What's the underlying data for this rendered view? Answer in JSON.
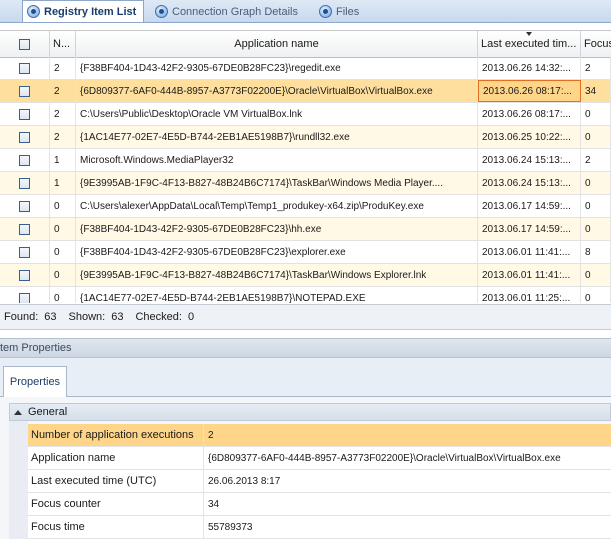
{
  "tabs": [
    {
      "label": "Registry Item List",
      "active": true,
      "icon": "registry-icon"
    },
    {
      "label": "Connection Graph Details",
      "active": false,
      "icon": "graph-icon"
    },
    {
      "label": "Files",
      "active": false,
      "icon": "files-icon"
    }
  ],
  "grid": {
    "columns": [
      {
        "key": "check",
        "label": ""
      },
      {
        "key": "n",
        "label": "N..."
      },
      {
        "key": "app",
        "label": "Application name"
      },
      {
        "key": "last",
        "label": "Last executed tim..."
      },
      {
        "key": "focus",
        "label": "Focus"
      }
    ],
    "rows": [
      {
        "n": "2",
        "app": "{F38BF404-1D43-42F2-9305-67DE0B28FC23}\\regedit.exe",
        "last": "2013.06.26  14:32:...",
        "focus": "2"
      },
      {
        "n": "2",
        "app": "{6D809377-6AF0-444B-8957-A3773F02200E}\\Oracle\\VirtualBox\\VirtualBox.exe",
        "last": "2013.06.26  08:17:...",
        "focus": "34"
      },
      {
        "n": "2",
        "app": "C:\\Users\\Public\\Desktop\\Oracle VM VirtualBox.lnk",
        "last": "2013.06.26  08:17:...",
        "focus": "0"
      },
      {
        "n": "2",
        "app": "{1AC14E77-02E7-4E5D-B744-2EB1AE5198B7}\\rundll32.exe",
        "last": "2013.06.25  10:22:...",
        "focus": "0"
      },
      {
        "n": "1",
        "app": "Microsoft.Windows.MediaPlayer32",
        "last": "2013.06.24  15:13:...",
        "focus": "2"
      },
      {
        "n": "1",
        "app": "{9E3995AB-1F9C-4F13-B827-48B24B6C7174}\\TaskBar\\Windows  Media  Player....",
        "last": "2013.06.24  15:13:...",
        "focus": "0"
      },
      {
        "n": "0",
        "app": "C:\\Users\\alexer\\AppData\\Local\\Temp\\Temp1_produkey-x64.zip\\ProduKey.exe",
        "last": "2013.06.17  14:59:...",
        "focus": "0"
      },
      {
        "n": "0",
        "app": "{F38BF404-1D43-42F2-9305-67DE0B28FC23}\\hh.exe",
        "last": "2013.06.17  14:59:...",
        "focus": "0"
      },
      {
        "n": "0",
        "app": "{F38BF404-1D43-42F2-9305-67DE0B28FC23}\\explorer.exe",
        "last": "2013.06.01  11:41:...",
        "focus": "8"
      },
      {
        "n": "0",
        "app": "{9E3995AB-1F9C-4F13-B827-48B24B6C7174}\\TaskBar\\Windows Explorer.lnk",
        "last": "2013.06.01  11:41:...",
        "focus": "0"
      },
      {
        "n": "0",
        "app": "{1AC14E77-02E7-4E5D-B744-2EB1AE5198B7}\\NOTEPAD.EXE",
        "last": "2013.06.01  11:25:...",
        "focus": "0"
      }
    ]
  },
  "status": {
    "found_label": "Found:",
    "found": "63",
    "shown_label": "Shown:",
    "shown": "63",
    "checked_label": "Checked:",
    "checked": "0"
  },
  "properties": {
    "panel_title": "tem Properties",
    "tab_label": "Properties",
    "group_label": "General",
    "rows": [
      {
        "name": "Number of application executions",
        "value": "2"
      },
      {
        "name": "Application name",
        "value": "{6D809377-6AF0-444B-8957-A3773F02200E}\\Oracle\\VirtualBox\\VirtualBox.exe"
      },
      {
        "name": "Last executed time (UTC)",
        "value": "26.06.2013 8:17"
      },
      {
        "name": "Focus counter",
        "value": "34"
      },
      {
        "name": "Focus time",
        "value": "55789373"
      }
    ]
  },
  "colors": {
    "selected_row": "#ffdf9e",
    "alt_row": "#fff9e6",
    "focus_border": "#e07020"
  }
}
